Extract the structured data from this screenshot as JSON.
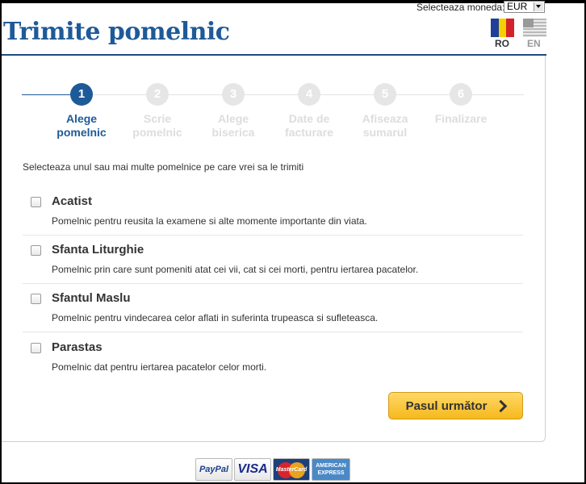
{
  "header": {
    "title": "Trimite pomelnic",
    "currency_label": "Selecteaza moneda:",
    "currency_value": "EUR",
    "languages": [
      {
        "code": "RO",
        "active": true
      },
      {
        "code": "EN",
        "active": false
      }
    ]
  },
  "steps": [
    {
      "number": "1",
      "line1": "Alege",
      "line2": "pomelnic",
      "active": true
    },
    {
      "number": "2",
      "line1": "Scrie",
      "line2": "pomelnic",
      "active": false
    },
    {
      "number": "3",
      "line1": "Alege",
      "line2": "biserica",
      "active": false
    },
    {
      "number": "4",
      "line1": "Date de",
      "line2": "facturare",
      "active": false
    },
    {
      "number": "5",
      "line1": "Afiseaza",
      "line2": "sumarul",
      "active": false
    },
    {
      "number": "6",
      "line1": "Finalizare",
      "line2": "",
      "active": false
    }
  ],
  "instruction": "Selecteaza unul sau mai multe pomelnice pe care vrei sa le trimiti",
  "options": [
    {
      "title": "Acatist",
      "description": "Pomelnic pentru reusita la examene si alte momente importante din viata.",
      "checked": false
    },
    {
      "title": "Sfanta Liturghie",
      "description": "Pomelnic prin care sunt pomeniti atat cei vii, cat si cei morti, pentru iertarea pacatelor.",
      "checked": false
    },
    {
      "title": "Sfantul Maslu",
      "description": "Pomelnic pentru vindecarea celor aflati in suferinta trupeasca si sufleteasca.",
      "checked": false
    },
    {
      "title": "Parastas",
      "description": "Pomelnic dat pentru iertarea pacatelor celor morti.",
      "checked": false
    }
  ],
  "next_button": "Pasul următor",
  "payment_logos": {
    "paypal": "PayPal",
    "visa": "VISA",
    "mastercard": "MasterCard",
    "amex_line1": "AMERICAN",
    "amex_line2": "EXPRESS"
  },
  "colors": {
    "brand_blue": "#1f5a98",
    "button_yellow": "#f6b81e",
    "inactive_step": "#e6e6e6"
  }
}
